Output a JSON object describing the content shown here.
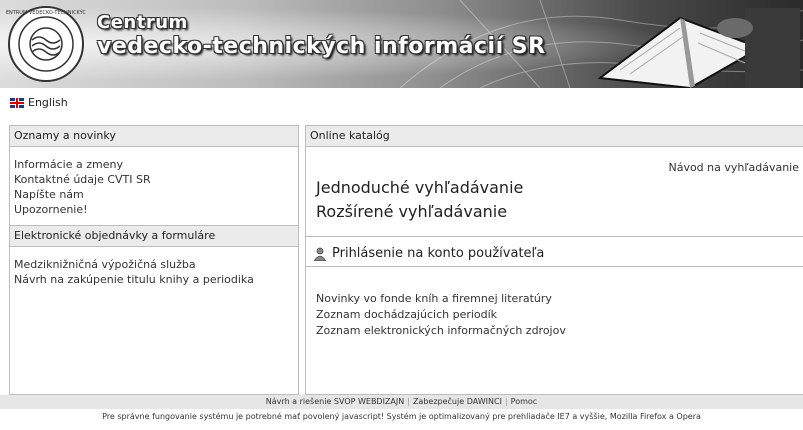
{
  "header": {
    "title_line1": "Centrum",
    "title_line2": "vedecko-technických informácií SR"
  },
  "language_link": "English",
  "left_panel": {
    "section1_title": "Oznamy a novinky",
    "section1_links": [
      "Informácie a zmeny",
      "Kontaktné údaje CVTI SR",
      "Napíšte nám",
      "Upozornenie!"
    ],
    "section2_title": "Elektronické objednávky a formuláre",
    "section2_links": [
      "Medziknižničná výpožičná služba",
      "Návrh na zakúpenie titulu knihy a periodika"
    ]
  },
  "right_panel": {
    "title": "Online katalóg",
    "help_link": "Návod na vyhľadávanie",
    "simple_search": "Jednoduché vyhľadávanie",
    "advanced_search": "Rozšírené vyhľadávanie",
    "login": "Prihlásenie na konto používateľa",
    "links": [
      "Novinky vo fonde kníh a firemnej literatúry",
      "Zoznam dochádzajúcich periodík",
      "Zoznam elektronických informačných zdrojov"
    ]
  },
  "footer": {
    "part1": "Návrh a riešenie SVOP WEBDIZAJN",
    "part2": "Zabezpečuje DAWINCI",
    "part3": "Pomoc",
    "note": "Pre správne fungovanie systému je potrebné mať povolený javascript! Systém je optimalizovaný pre prehliadače IE7 a vyššie, Mozilla Firefox a Opera"
  }
}
